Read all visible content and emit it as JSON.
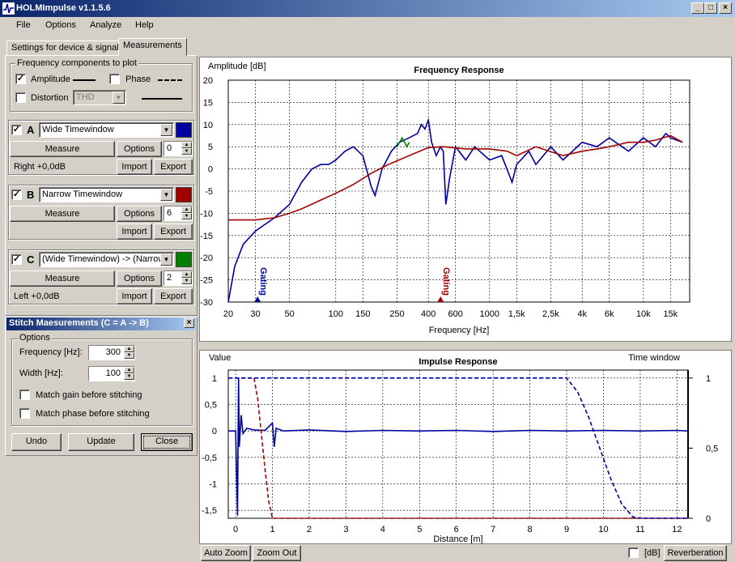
{
  "window": {
    "title": "HOLMImpulse  v1.1.5.6",
    "buttons": {
      "minimize": "_",
      "maximize": "□",
      "close": "×"
    }
  },
  "menu": [
    "File",
    "Options",
    "Analyze",
    "Help"
  ],
  "tabs": [
    "Settings for device & signal",
    "Measurements"
  ],
  "freq_components": {
    "title": "Frequency components to plot",
    "amplitude_label": "Amplitude",
    "amplitude_checked": true,
    "phase_label": "Phase",
    "phase_checked": false,
    "distortion_label": "Distortion",
    "distortion_checked": false,
    "distortion_value": "THD"
  },
  "measurements": [
    {
      "letter": "A",
      "checked": true,
      "name": "Wide Timewindow",
      "color": "#0000a0",
      "measure": "Measure",
      "options": "Options",
      "spin": "0",
      "info": "Right +0,0dB",
      "import": "Import",
      "export": "Export"
    },
    {
      "letter": "B",
      "checked": true,
      "name": "Narrow Timewindow",
      "color": "#a00000",
      "measure": "Measure",
      "options": "Options",
      "spin": "6",
      "info": "",
      "import": "Import",
      "export": "Export"
    },
    {
      "letter": "C",
      "checked": true,
      "name": "(Wide Timewindow) -> (Narrow",
      "color": "#008000",
      "measure": "Measure",
      "options": "Options",
      "spin": "2",
      "info": "Left +0,0dB",
      "import": "Import",
      "export": "Export"
    }
  ],
  "stitch": {
    "title": "Stitch Maesurements (C = A -> B)",
    "close": "×",
    "options_label": "Options",
    "frequency_label": "Frequency [Hz]:",
    "frequency_value": "300",
    "width_label": "Width [Hz]:",
    "width_value": "100",
    "match_gain": "Match gain before stitching",
    "match_phase": "Match phase before stitching",
    "undo": "Undo",
    "update": "Update",
    "close_btn": "Close"
  },
  "split_arrows": {
    "up": "▲",
    "down": "▼"
  },
  "bottom_bar": {
    "auto_zoom": "Auto Zoom",
    "zoom_out": "Zoom Out",
    "db_label": "[dB]",
    "reverberation": "Reverberation"
  },
  "chart_data": [
    {
      "type": "line",
      "title": "Frequency Response",
      "ylabel": "Amplitude [dB]",
      "xlabel": "Frequency [Hz]",
      "xscale": "log",
      "xlim": [
        20,
        20000
      ],
      "ylim": [
        -30,
        20
      ],
      "grid": true,
      "x_ticks": [
        20,
        30,
        50,
        100,
        150,
        250,
        400,
        600,
        1000,
        1500,
        2500,
        4000,
        6000,
        10000,
        15000
      ],
      "x_tick_labels": [
        "20",
        "30",
        "50",
        "100",
        "150",
        "250",
        "400",
        "600",
        "1000",
        "1,5k",
        "2,5k",
        "4k",
        "6k",
        "10k",
        "15k"
      ],
      "y_ticks": [
        20,
        15,
        10,
        5,
        0,
        -5,
        -10,
        -15,
        -20,
        -25,
        -30
      ],
      "annotations": [
        {
          "text": "Gating",
          "x": 31,
          "color": "#0000a0"
        },
        {
          "text": "Gating",
          "x": 480,
          "color": "#a00000"
        }
      ],
      "series": [
        {
          "color": "#0000a0",
          "x": [
            20,
            22,
            25,
            30,
            40,
            50,
            60,
            70,
            80,
            90,
            100,
            115,
            130,
            150,
            170,
            180,
            200,
            230,
            260,
            300,
            340,
            360,
            380,
            400,
            420,
            450,
            480,
            500,
            520,
            550,
            600,
            700,
            800,
            1000,
            1200,
            1400,
            1500,
            1800,
            2000,
            2500,
            3000,
            4000,
            5000,
            6000,
            8000,
            10000,
            12000,
            14000,
            15000,
            18000
          ],
          "y": [
            -30,
            -22,
            -17,
            -14,
            -11,
            -8,
            -3,
            0,
            1,
            1,
            2,
            4,
            5,
            3,
            -4,
            -6,
            0,
            4,
            6,
            7,
            8,
            10,
            9,
            11,
            6,
            3,
            5,
            4,
            -8,
            -2,
            5,
            2,
            5,
            2,
            3,
            -3,
            1,
            4,
            1,
            5,
            2,
            6,
            5,
            7,
            4,
            7,
            5,
            8,
            7,
            6
          ]
        },
        {
          "color": "#a00000",
          "x": [
            20,
            30,
            40,
            50,
            60,
            80,
            100,
            130,
            170,
            220,
            300,
            400,
            500,
            700,
            1000,
            1300,
            1500,
            2000,
            3000,
            4000,
            5000,
            6000,
            8000,
            10000,
            12000,
            15000,
            18000
          ],
          "y": [
            -11.5,
            -11.5,
            -11,
            -10,
            -9,
            -7,
            -5.5,
            -3.5,
            -1,
            1,
            3,
            4.8,
            5,
            4.5,
            4.5,
            4,
            3,
            5,
            3,
            4,
            4.5,
            5,
            6,
            6,
            6.5,
            7.5,
            6
          ]
        },
        {
          "color": "#008000",
          "x": [
            250,
            260,
            270,
            280,
            290,
            300
          ],
          "y": [
            5,
            6,
            7,
            6,
            5,
            6
          ]
        }
      ]
    },
    {
      "type": "line",
      "title": "Impulse Response",
      "ylabel": "Value",
      "y2label": "Time window",
      "xlabel": "Distance [m]",
      "xlim": [
        -0.2,
        12.3
      ],
      "ylim": [
        -1.65,
        1.15
      ],
      "y2lim": [
        0,
        1
      ],
      "grid": true,
      "x_ticks": [
        0,
        1,
        2,
        3,
        4,
        5,
        6,
        7,
        8,
        9,
        10,
        11,
        12
      ],
      "y_ticks": [
        1,
        0.5,
        0,
        -0.5,
        -1,
        -1.5
      ],
      "y_tick_labels": [
        "1",
        "0,5",
        "0",
        "-0,5",
        "-1",
        "-1,5"
      ],
      "y2_ticks": [
        1,
        0.5,
        0
      ],
      "y2_tick_labels": [
        "1",
        "0,5",
        "0"
      ],
      "series": [
        {
          "name_shown": false,
          "color": "#0000a0",
          "style": "solid",
          "x": [
            -0.2,
            0.0,
            0.05,
            0.08,
            0.1,
            0.15,
            0.2,
            0.3,
            0.5,
            0.8,
            1.0,
            1.05,
            1.1,
            1.3,
            2,
            3,
            4,
            5,
            6,
            7,
            8,
            9,
            10,
            11,
            12,
            12.3
          ],
          "y": [
            0,
            0,
            -1.6,
            1.0,
            -0.3,
            0.3,
            -0.05,
            0.05,
            0.02,
            0.01,
            0.15,
            -0.3,
            0.05,
            0,
            0.02,
            -0.01,
            0.01,
            0,
            0.01,
            -0.01,
            0.01,
            0,
            0.01,
            0,
            0.01,
            0
          ]
        },
        {
          "color": "#a00000",
          "style": "dashed",
          "axis": "y2",
          "x": [
            -0.2,
            0.5,
            0.6,
            0.7,
            0.8,
            0.9,
            1.0,
            12.3
          ],
          "y": [
            1,
            1,
            0.85,
            0.6,
            0.35,
            0.12,
            0,
            0
          ]
        },
        {
          "color": "#0000a0",
          "style": "dashed",
          "axis": "y2",
          "x": [
            -0.2,
            9.0,
            9.3,
            9.6,
            9.9,
            10.2,
            10.5,
            10.8,
            11.0,
            12.3
          ],
          "y": [
            1,
            1,
            0.9,
            0.72,
            0.5,
            0.28,
            0.1,
            0.01,
            0,
            0
          ]
        }
      ]
    }
  ]
}
